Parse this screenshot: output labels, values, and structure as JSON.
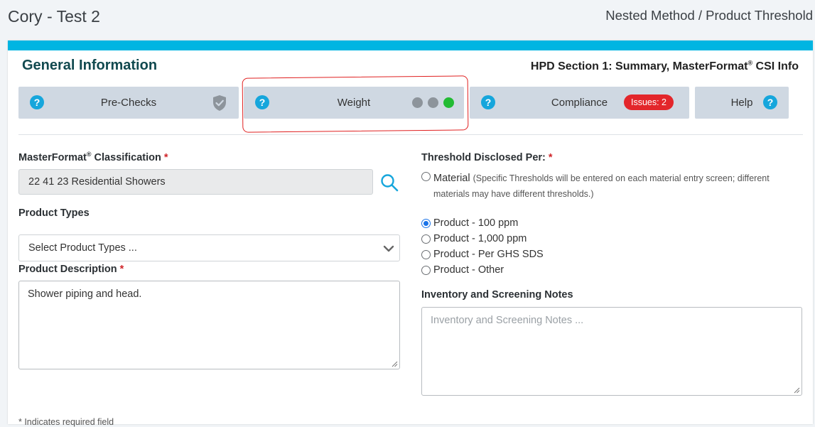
{
  "header": {
    "title": "Cory - Test 2",
    "breadcrumb": "Nested Method / Product Threshold"
  },
  "section": {
    "title": "General Information",
    "subtitle_pre": "HPD Section 1: Summary, MasterFormat",
    "subtitle_sup": "®",
    "subtitle_post": " CSI Info"
  },
  "tabs": [
    {
      "label": "Pre-Checks",
      "help": "?"
    },
    {
      "label": "Weight",
      "help": "?"
    },
    {
      "label": "Compliance",
      "help": "?",
      "badge": "Issues: 2"
    },
    {
      "label": "Help",
      "help": "?"
    }
  ],
  "form": {
    "masterformat_label": "MasterFormat",
    "masterformat_sup": "®",
    "masterformat_label_post": " Classification",
    "required_mark": "*",
    "masterformat_value": "22 41 23 Residential Showers",
    "product_types_label": "Product Types",
    "product_types_placeholder": "Select Product Types ...",
    "description_label": "Product Description",
    "description_value": "Shower piping and head.",
    "threshold_label": "Threshold Disclosed Per:",
    "threshold_options": [
      {
        "label": "Material",
        "note": "(Specific Thresholds will be entered on each material entry screen; different materials may have different thresholds.)",
        "checked": false
      },
      {
        "label": "Product - 100 ppm",
        "checked": true
      },
      {
        "label": "Product - 1,000 ppm",
        "checked": false
      },
      {
        "label": "Product - Per GHS SDS",
        "checked": false
      },
      {
        "label": "Product - Other",
        "checked": false
      }
    ],
    "notes_label": "Inventory and Screening Notes",
    "notes_placeholder": "Inventory and Screening Notes ...",
    "footnote": "* Indicates required field"
  },
  "colors": {
    "accent_bar": "#00b5e2",
    "tab_bg": "#cfd8e2",
    "help_icon": "#16a6dc",
    "issues_badge": "#e3262b",
    "status_green": "#22bb33",
    "annotation": "#e02020"
  }
}
